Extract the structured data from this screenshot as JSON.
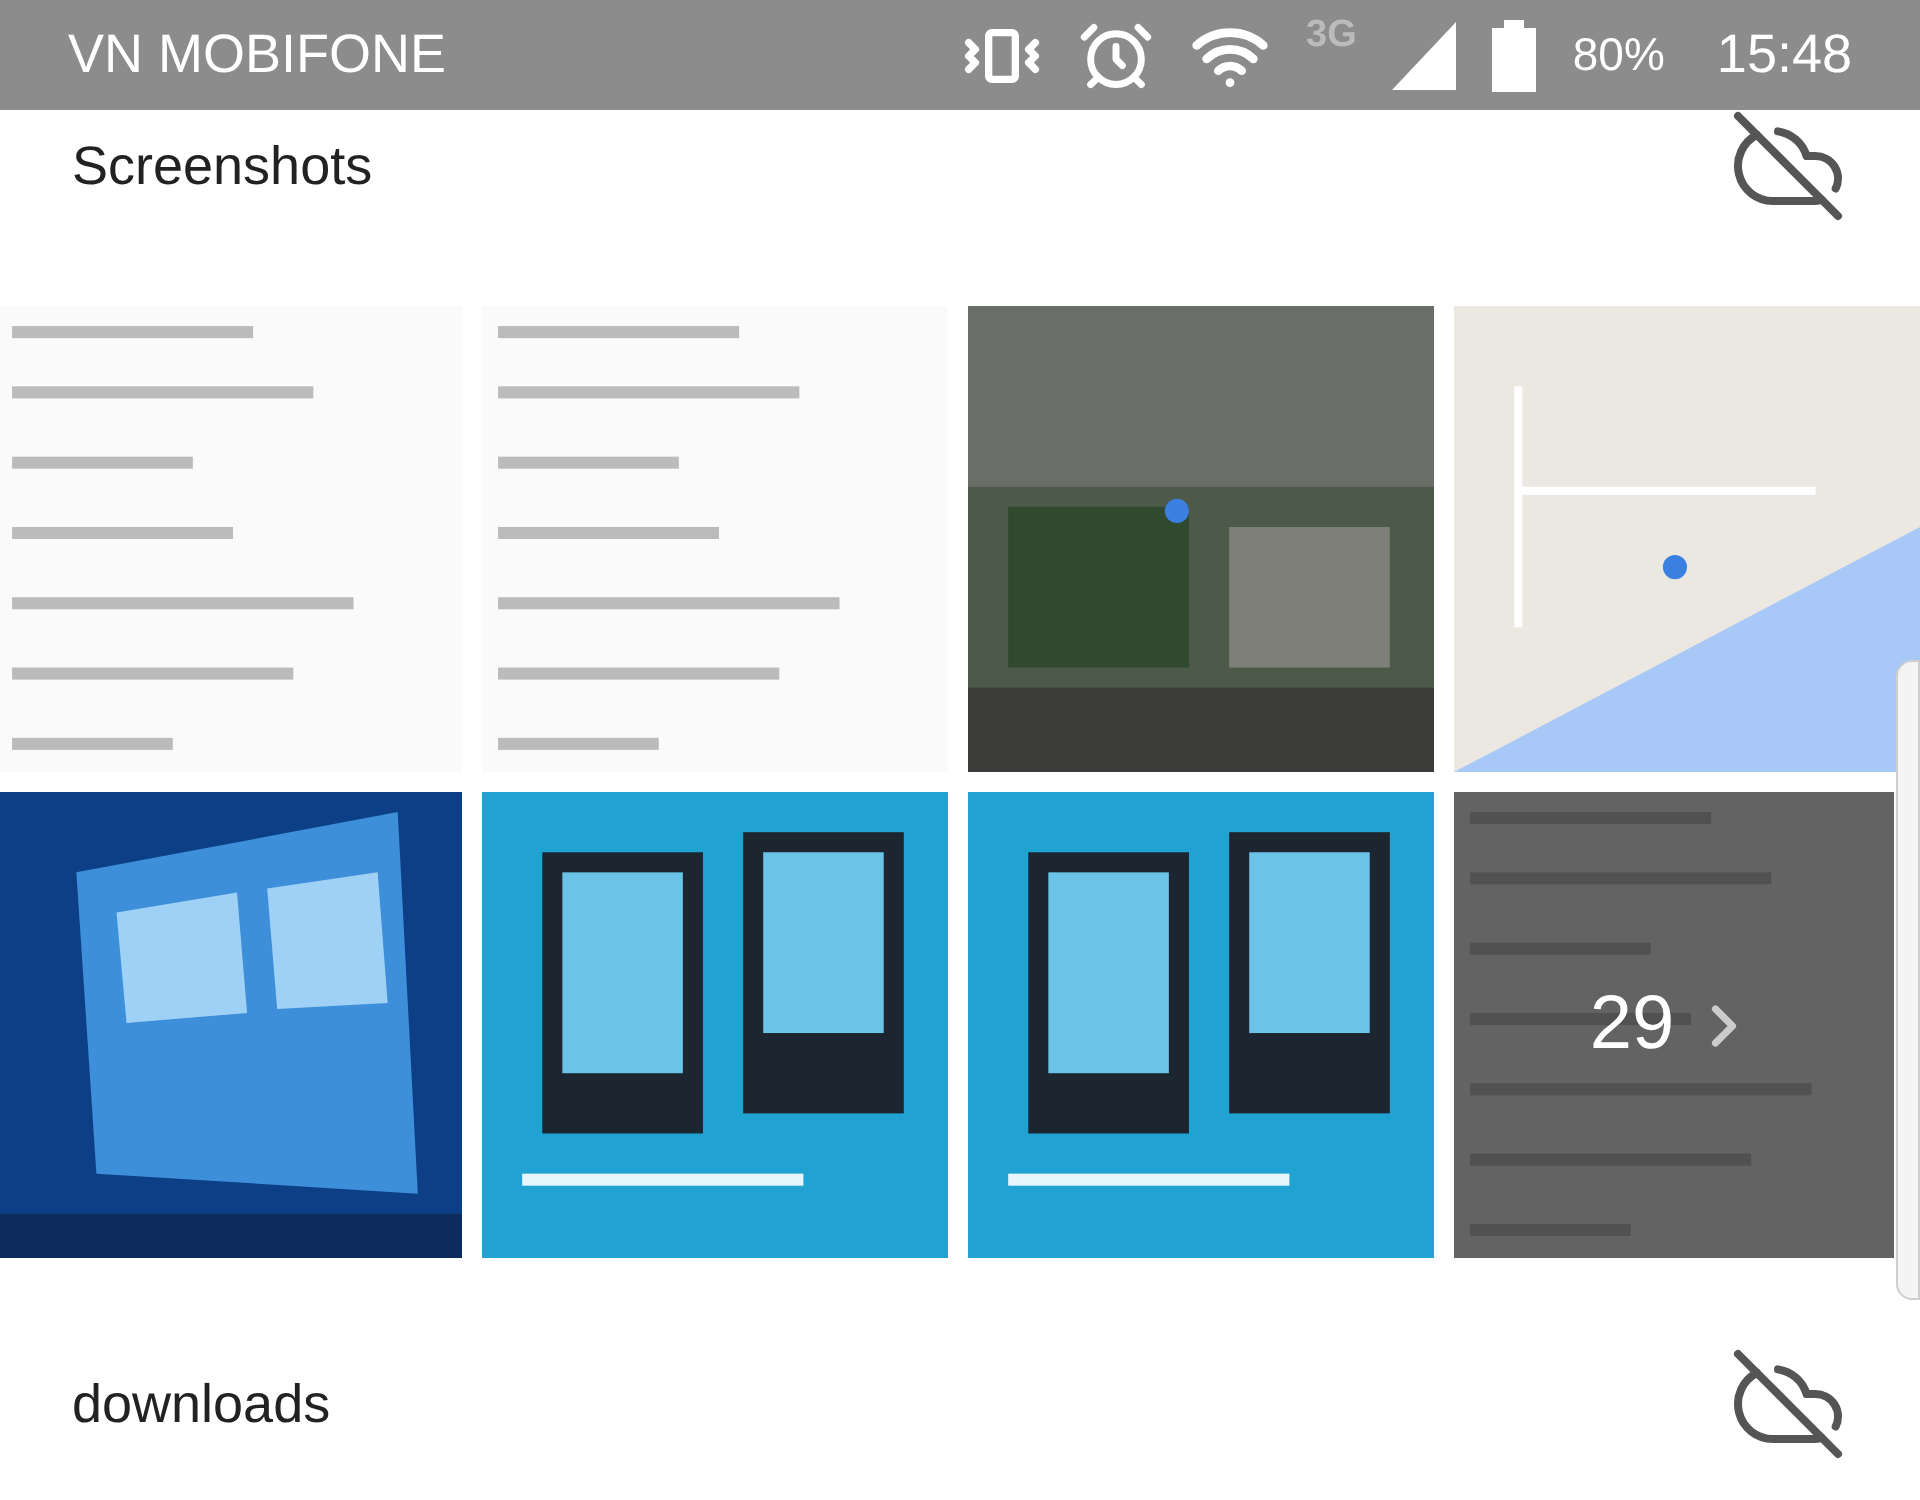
{
  "status_bar": {
    "carrier": "VN MOBIFONE",
    "network": "3G",
    "battery": "80%",
    "time": "15:48"
  },
  "albums": [
    {
      "title": "Screenshots",
      "synced": false,
      "more_count": "29"
    },
    {
      "title": "downloads",
      "synced": false
    }
  ]
}
